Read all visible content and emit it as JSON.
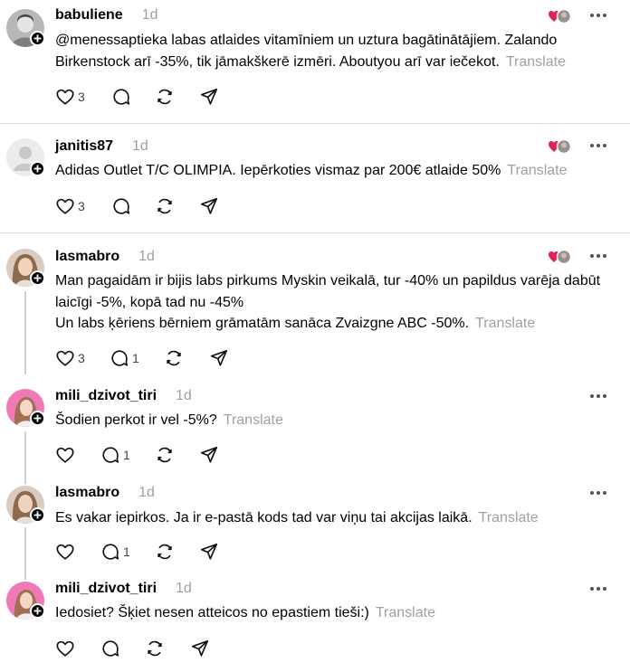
{
  "colors": {
    "heart_red": "#e0245e",
    "divider": "#d9d9d9",
    "muted": "#a0a0a0"
  },
  "posts": [
    {
      "username": "babuliene",
      "time": "1d",
      "lines": [
        "@menessaptieka labas atlaides vitamīniem un uztura bagātinātājiem. Zalando Birkenstock arī -35%, tik jāmakškerē izmēri. Aboutyou arī var iečekot."
      ],
      "translate": "Translate",
      "like_count": "3",
      "reply_count": ""
    },
    {
      "username": "janitis87",
      "time": "1d",
      "lines": [
        "Adidas Outlet T/C OLIMPIA. Iepērkoties vismaz par 200€ atlaide 50%"
      ],
      "translate": "Translate",
      "like_count": "3",
      "reply_count": ""
    },
    {
      "username": "lasmabro",
      "time": "1d",
      "lines": [
        "Man pagaidām ir bijis labs pirkums Myskin veikalā, tur -40% un papildus varēja dabūt laicīgi -5%, kopā tad nu -45%",
        "Un labs ķēriens bērniem grāmatām sanāca Zvaizgne ABC -50%."
      ],
      "translate": "Translate",
      "like_count": "3",
      "reply_count": "1"
    },
    {
      "username": "mili_dzivot_tiri",
      "time": "1d",
      "lines": [
        "Šodien perkot ir vel -5%?"
      ],
      "translate": "Translate",
      "like_count": "",
      "reply_count": "1"
    },
    {
      "username": "lasmabro",
      "time": "1d",
      "lines": [
        "Es vakar iepirkos. Ja ir e-pastā kods tad var viņu tai akcijas laikā."
      ],
      "translate": "Translate",
      "like_count": "",
      "reply_count": "1"
    },
    {
      "username": "mili_dzivot_tiri",
      "time": "1d",
      "lines": [
        "Iedosiet? Šķiet nesen atteicos no epastiem tieši:)"
      ],
      "translate": "Translate",
      "like_count": "",
      "reply_count": ""
    }
  ]
}
